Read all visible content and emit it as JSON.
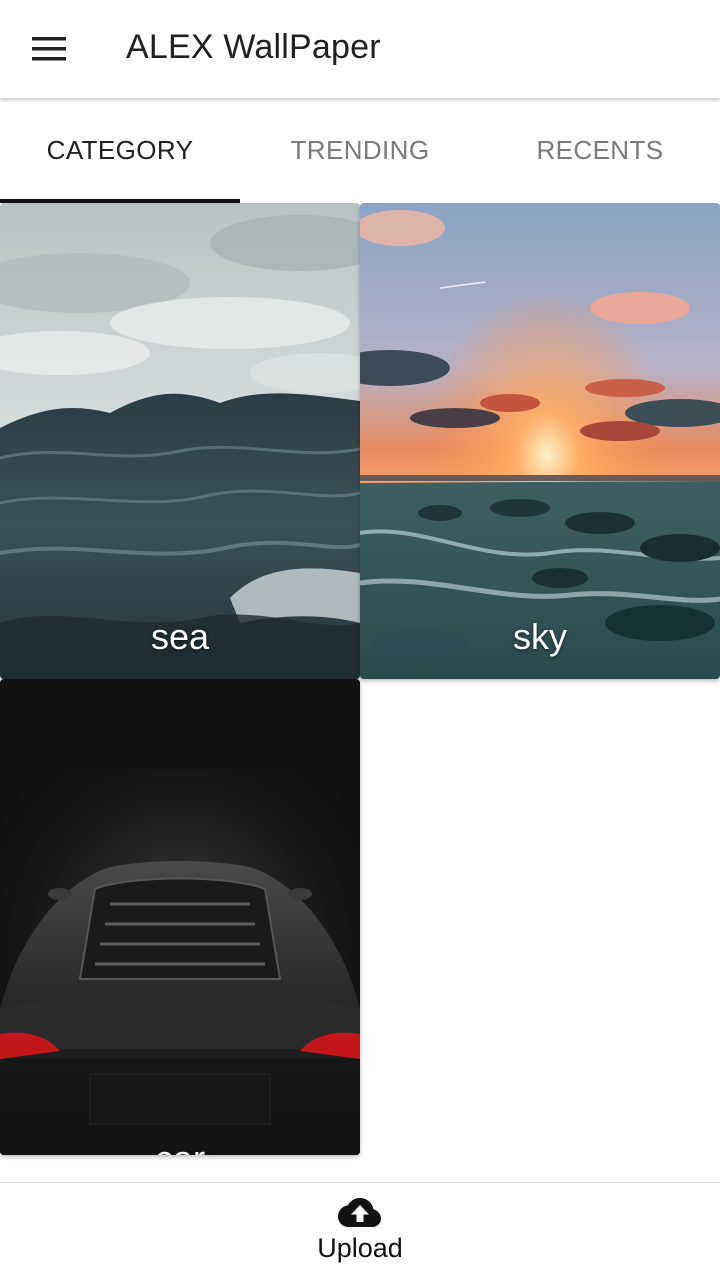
{
  "app": {
    "title": "ALEX WallPaper",
    "menu_icon": "hamburger-menu-icon"
  },
  "tabs": [
    {
      "label": "CATEGORY",
      "active": true
    },
    {
      "label": "TRENDING",
      "active": false
    },
    {
      "label": "RECENTS",
      "active": false
    }
  ],
  "categories": [
    {
      "label": "sea",
      "image": "stormy-sea-waves"
    },
    {
      "label": "sky",
      "image": "sunset-over-rocky-shore"
    },
    {
      "label": "car",
      "image": "black-sports-car-rear"
    }
  ],
  "bottom_bar": {
    "upload_label": "Upload",
    "upload_icon": "cloud-upload-icon"
  },
  "colors": {
    "tab_active": "#212121",
    "tab_inactive": "#7a7a7a",
    "indicator": "#111111",
    "label_text": "#ffffff"
  }
}
